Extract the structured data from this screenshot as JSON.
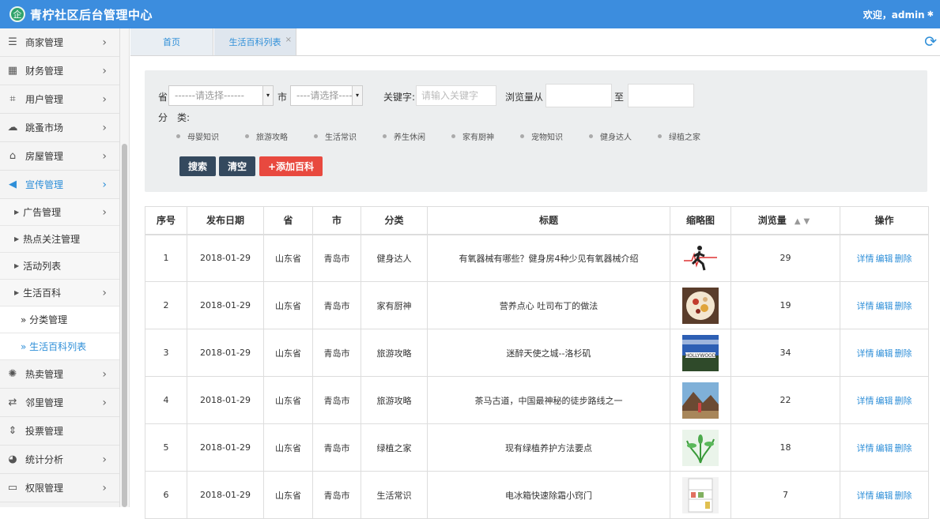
{
  "header": {
    "logo_glyph": "企",
    "title": "青柠社区后台管理中心",
    "welcome": "欢迎，admin"
  },
  "sidebar": {
    "items": [
      {
        "label": "商家管理",
        "icon": "list-icon"
      },
      {
        "label": "财务管理",
        "icon": "calculator-icon"
      },
      {
        "label": "用户管理",
        "icon": "crop-icon"
      },
      {
        "label": "跳蚤市场",
        "icon": "cloud-icon"
      },
      {
        "label": "房屋管理",
        "icon": "bank-icon"
      },
      {
        "label": "宣传管理",
        "icon": "megaphone-icon"
      }
    ],
    "sub_items": [
      "广告管理",
      "热点关注管理",
      "活动列表",
      "生活百科"
    ],
    "sub2_items": [
      "» 分类管理",
      "» 生活百科列表"
    ],
    "bottom_items": [
      {
        "label": "热卖管理",
        "icon": "sun-icon"
      },
      {
        "label": "邻里管理",
        "icon": "retweet-icon"
      },
      {
        "label": "投票管理",
        "icon": "sort-icon"
      },
      {
        "label": "统计分析",
        "icon": "pie-chart-icon"
      },
      {
        "label": "权限管理",
        "icon": "monitor-icon"
      }
    ]
  },
  "tabs": [
    "首页",
    "生活百科列表"
  ],
  "filter": {
    "province_label": "省",
    "province_value": "------请选择------",
    "city_label": "市",
    "city_value": "----请选择----",
    "keyword_label": "关键字:",
    "keyword_placeholder": "请输入关键字",
    "views_from_label": "浏览量从",
    "views_to_label": "至",
    "category_label": "分　类:",
    "categories": [
      "母婴知识",
      "旅游攻略",
      "生活常识",
      "养生休闲",
      "家有厨神",
      "宠物知识",
      "健身达人",
      "绿植之家"
    ],
    "search_button": "搜索",
    "clear_button": "清空",
    "add_button": "+添加百科"
  },
  "table": {
    "headers": [
      "序号",
      "发布日期",
      "省",
      "市",
      "分类",
      "标题",
      "缩略图",
      "浏览量",
      "操作"
    ],
    "sort_glyphs": "▲▼",
    "actions": [
      "详情",
      "编辑",
      "删除"
    ],
    "rows": [
      {
        "no": "1",
        "date": "2018-01-29",
        "province": "山东省",
        "city": "青岛市",
        "category": "健身达人",
        "title": "有氧器械有哪些？健身房4种少见有氧器械介绍",
        "views": "29",
        "thumb": "runner"
      },
      {
        "no": "2",
        "date": "2018-01-29",
        "province": "山东省",
        "city": "青岛市",
        "category": "家有厨神",
        "title": "营养点心 吐司布丁的做法",
        "views": "19",
        "thumb": "food"
      },
      {
        "no": "3",
        "date": "2018-01-29",
        "province": "山东省",
        "city": "青岛市",
        "category": "旅游攻略",
        "title": "迷醉天使之城--洛杉矶",
        "views": "34",
        "thumb": "hollywood"
      },
      {
        "no": "4",
        "date": "2018-01-29",
        "province": "山东省",
        "city": "青岛市",
        "category": "旅游攻略",
        "title": "茶马古道，中国最神秘的徒步路线之一",
        "views": "22",
        "thumb": "landscape"
      },
      {
        "no": "5",
        "date": "2018-01-29",
        "province": "山东省",
        "city": "青岛市",
        "category": "绿植之家",
        "title": "现有绿植养护方法要点",
        "views": "18",
        "thumb": "plant"
      },
      {
        "no": "6",
        "date": "2018-01-29",
        "province": "山东省",
        "city": "青岛市",
        "category": "生活常识",
        "title": "电冰箱快速除霜小窍门",
        "views": "7",
        "thumb": "fridge"
      }
    ]
  }
}
